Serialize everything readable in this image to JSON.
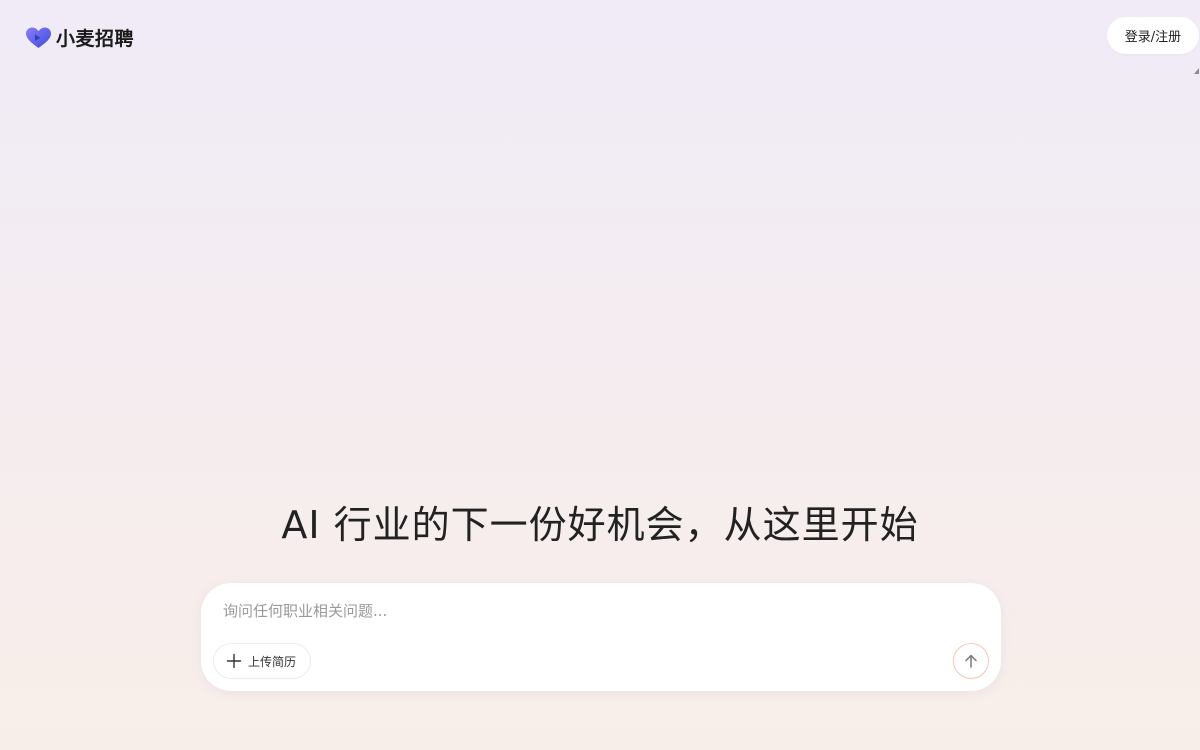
{
  "header": {
    "brand_name": "小麦招聘",
    "logo_icon": "heart-logo-icon",
    "login_label": "登录/注册"
  },
  "hero": {
    "title": "AI 行业的下一份好机会，从这里开始"
  },
  "chat": {
    "placeholder": "询问任何职业相关问题...",
    "value": "",
    "upload_icon": "plus-icon",
    "upload_label": "上传简历",
    "send_icon": "arrow-up-icon"
  },
  "colors": {
    "brand_gradient_start": "#7a6cf0",
    "brand_gradient_end": "#3d4fe0",
    "send_border": "#f5c7b2",
    "background_top": "#f0ebf7",
    "background_bottom": "#f8eee9"
  }
}
